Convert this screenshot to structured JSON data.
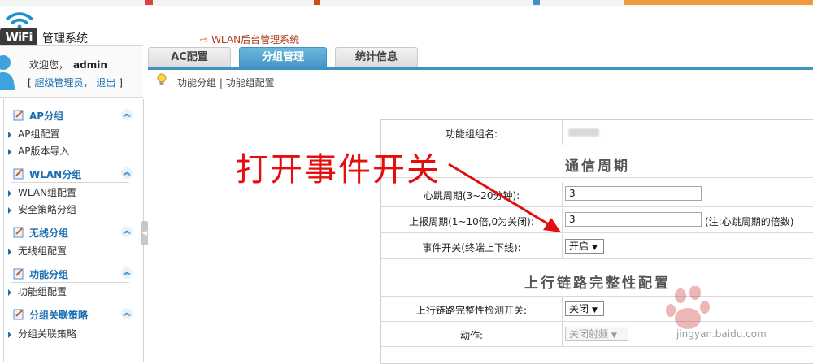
{
  "app": {
    "logo_text": "WiFi",
    "system_title": "管理系统",
    "top_breadcrumb": "WLAN后台管理系统"
  },
  "user": {
    "welcome_prefix": "欢迎您，",
    "username": "admin",
    "role_link": "超级管理员",
    "logout_link": "退出",
    "bracket_open": "[",
    "comma": "，",
    "bracket_close": "]"
  },
  "tabs": [
    {
      "label": "AC配置",
      "active": false
    },
    {
      "label": "分组管理",
      "active": true
    },
    {
      "label": "统计信息",
      "active": false
    }
  ],
  "subnav": {
    "path": "功能分组 | 功能组配置"
  },
  "sidebar": {
    "groups": [
      {
        "title": "AP分组",
        "items": [
          "AP组配置",
          "AP版本导入"
        ]
      },
      {
        "title": "WLAN分组",
        "items": [
          "WLAN组配置",
          "安全策略分组"
        ]
      },
      {
        "title": "无线分组",
        "items": [
          "无线组配置"
        ]
      },
      {
        "title": "功能分组",
        "items": [
          "功能组配置"
        ]
      },
      {
        "title": "分组关联策略",
        "items": [
          "分组关联策略"
        ]
      }
    ]
  },
  "form": {
    "group_name_label": "功能组组名:",
    "section_comm": "通信周期",
    "heartbeat_label": "心跳周期(3~20分钟):",
    "heartbeat_value": "3",
    "report_label": "上报周期(1~10倍,0为关闭):",
    "report_value": "3",
    "report_note": "(注:心跳周期的倍数)",
    "event_label": "事件开关(终端上下线):",
    "event_value": "开启",
    "section_uplink": "上行链路完整性配置",
    "uplink_detect_label": "上行链路完整性检测开关:",
    "uplink_detect_value": "关闭",
    "action_label": "动作:",
    "action_value": "关闭射频"
  },
  "annotation": {
    "text": "打开事件开关"
  },
  "watermark": {
    "text": "jingyan.baidu.com"
  },
  "colors": {
    "accent": "#3f93c4",
    "annotation": "#e30e0e",
    "link": "#1a6fb3"
  }
}
